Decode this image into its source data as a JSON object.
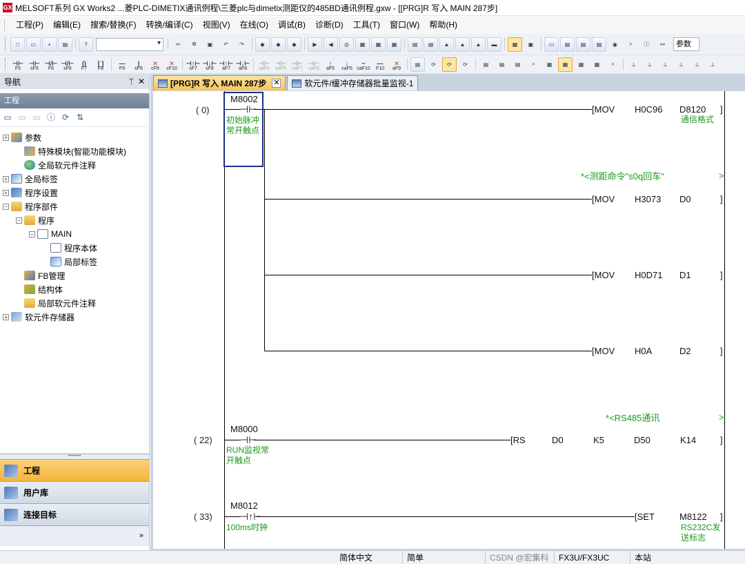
{
  "window": {
    "title": "MELSOFT系列 GX Works2 ...菱PLC-DIMETIX通讯例程\\三菱plc与dimetix测距仪的485BD通讯例程.gxw - [[PRG]R 写入 MAIN 287步]",
    "app_icon_text": "GX"
  },
  "menu": [
    "工程(P)",
    "编辑(E)",
    "搜索/替换(F)",
    "转换/编译(C)",
    "视图(V)",
    "在线(O)",
    "调试(B)",
    "诊断(D)",
    "工具(T)",
    "窗口(W)",
    "帮助(H)"
  ],
  "toolbar": {
    "param_box": "参数",
    "fkeys": [
      {
        "key": "F5",
        "glyph": "⊣⊢"
      },
      {
        "key": "sF5",
        "glyph": "⊣⊢"
      },
      {
        "key": "F6",
        "glyph": "⊣/⊢"
      },
      {
        "key": "sF6",
        "glyph": "⊣/⊢"
      },
      {
        "key": "F7",
        "glyph": "()"
      },
      {
        "key": "F8",
        "glyph": "[ ]"
      },
      {
        "key": "F9",
        "glyph": "—"
      },
      {
        "key": "sF9",
        "glyph": "|"
      },
      {
        "key": "cF9",
        "glyph": "✕"
      },
      {
        "key": "cF10",
        "glyph": "✕"
      },
      {
        "key": "sF7",
        "glyph": "⊣↑⊢"
      },
      {
        "key": "sF8",
        "glyph": "⊣↓⊢"
      },
      {
        "key": "aF7",
        "glyph": "⊣↑⊢"
      },
      {
        "key": "aF8",
        "glyph": "⊣↓⊢"
      },
      {
        "key": "saF5",
        "glyph": "⊣⊢"
      },
      {
        "key": "saF6",
        "glyph": "⊣⊢"
      },
      {
        "key": "saF7",
        "glyph": "⊣⊢"
      },
      {
        "key": "saF8",
        "glyph": "⊣⊢"
      },
      {
        "key": "aF5",
        "glyph": "↑"
      },
      {
        "key": "caF5",
        "glyph": "↓"
      },
      {
        "key": "caF10",
        "glyph": "~"
      },
      {
        "key": "F10",
        "glyph": "—"
      },
      {
        "key": "aF9",
        "glyph": "✕"
      }
    ]
  },
  "nav": {
    "header": "导航",
    "pin_icon": "ᛘ",
    "close_icon": "✕",
    "section": "工程",
    "tree": [
      {
        "label": "参数",
        "expander": "+",
        "icon": "param",
        "indent": 0
      },
      {
        "label": "特殊模块(智能功能模块)",
        "expander": "",
        "icon": "module",
        "indent": 1
      },
      {
        "label": "全局软元件注释",
        "expander": "",
        "icon": "globe",
        "indent": 1
      },
      {
        "label": "全局标签",
        "expander": "+",
        "icon": "label",
        "indent": 0
      },
      {
        "label": "程序设置",
        "expander": "+",
        "icon": "settings",
        "indent": 0
      },
      {
        "label": "程序部件",
        "expander": "−",
        "icon": "folder",
        "indent": 0
      },
      {
        "label": "程序",
        "expander": "−",
        "icon": "folder",
        "indent": 1
      },
      {
        "label": "MAIN",
        "expander": "−",
        "icon": "prog",
        "indent": 2
      },
      {
        "label": "程序本体",
        "expander": "",
        "icon": "prog",
        "indent": 3
      },
      {
        "label": "局部标签",
        "expander": "",
        "icon": "label",
        "indent": 3
      },
      {
        "label": "FB管理",
        "expander": "",
        "icon": "fb",
        "indent": 1
      },
      {
        "label": "结构体",
        "expander": "",
        "icon": "struct",
        "indent": 1
      },
      {
        "label": "局部软元件注释",
        "expander": "",
        "icon": "folder",
        "indent": 1
      },
      {
        "label": "软元件存储器",
        "expander": "+",
        "icon": "mem",
        "indent": 0
      }
    ],
    "bottom_buttons": [
      {
        "label": "工程",
        "active": true
      },
      {
        "label": "用户库",
        "active": false
      },
      {
        "label": "连接目标",
        "active": false
      }
    ],
    "more": "»"
  },
  "tabs": [
    {
      "label": "[PRG]R 写入 MAIN 287步",
      "active": true,
      "close": "✕"
    },
    {
      "label": "软元件/缓冲存储器批量监视-1",
      "active": false,
      "close": ""
    }
  ],
  "ladder": {
    "rungs": [
      {
        "step": "( 0)",
        "contact": "M8002",
        "contact_comment": [
          "初始脉冲",
          "常开触点"
        ]
      },
      {
        "step": "( 22)",
        "contact": "M8000",
        "contact_comment": [
          "RUN监视常",
          "开触点"
        ]
      },
      {
        "step": "( 33)",
        "contact": "M8012",
        "contact_comment": [
          "100ms时钟"
        ]
      }
    ],
    "instructions": [
      {
        "op": "[MOV",
        "a": "H0C96",
        "b": "D8120",
        "close": "]",
        "comment": "通信格式"
      },
      {
        "op": "[MOV",
        "a": "H3073",
        "b": "D0",
        "close": "]",
        "comment": ""
      },
      {
        "op": "[MOV",
        "a": "H0D71",
        "b": "D1",
        "close": "]",
        "comment": ""
      },
      {
        "op": "[MOV",
        "a": "H0A",
        "b": "D2",
        "close": "]",
        "comment": ""
      },
      {
        "op": "[RS",
        "a": "D0",
        "b": "K5",
        "c": "D50",
        "d": "K14",
        "close": "]",
        "comment": ""
      },
      {
        "op": "[SET",
        "a": "M8122",
        "close": "]",
        "comment_lines": [
          "RS232C发",
          "送标志"
        ]
      }
    ],
    "statements": [
      {
        "text": "*<测距命令\"s0q回车\"",
        "arrow": ">"
      },
      {
        "text": "*<RS485通讯",
        "arrow": ">"
      }
    ]
  },
  "status": {
    "language": "简体中文",
    "mode": "简单",
    "plc": "FX3U/FX3UC",
    "station": "本站",
    "watermark": "CSDN @宏集科技工业物联网"
  }
}
